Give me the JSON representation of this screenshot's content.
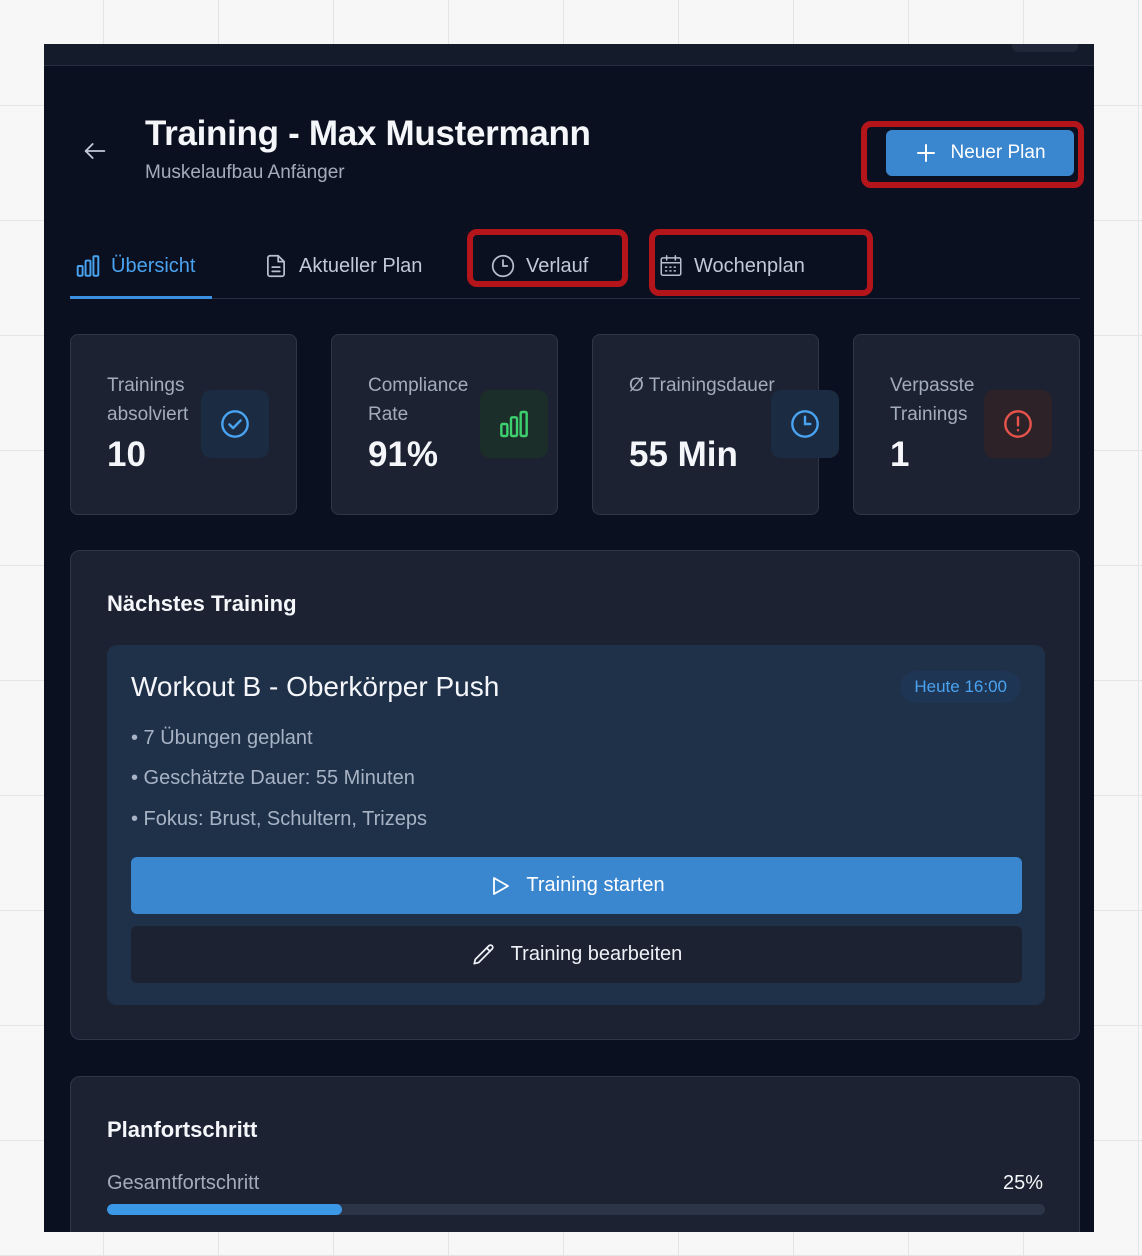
{
  "header": {
    "title": "Training - Max Mustermann",
    "subtitle": "Muskelaufbau Anfänger",
    "new_plan_label": "Neuer Plan",
    "icons": {
      "back": "arrow-left-icon",
      "new_plan": "plus-icon"
    }
  },
  "tabs": [
    {
      "label": "Übersicht",
      "icon": "bar-chart-icon",
      "active": true
    },
    {
      "label": "Aktueller Plan",
      "icon": "document-icon",
      "active": false
    },
    {
      "label": "Verlauf",
      "icon": "clock-icon",
      "active": false
    },
    {
      "label": "Wochenplan",
      "icon": "calendar-icon",
      "active": false
    }
  ],
  "stats": [
    {
      "label": "Trainings absolviert",
      "value": "10",
      "icon": "check-circle-icon",
      "color": "#4aa3f0"
    },
    {
      "label": "Compliance Rate",
      "value": "91%",
      "icon": "bar-chart-icon",
      "color": "#3ecf6e"
    },
    {
      "label": "Ø Trainingsdauer",
      "value": "55 Min",
      "icon": "clock-icon",
      "color": "#4aa3f0"
    },
    {
      "label": "Verpasste Trainings",
      "value": "1",
      "icon": "alert-circle-icon",
      "color": "#e5534b"
    }
  ],
  "next_training": {
    "heading": "Nächstes Training",
    "workout_title": "Workout B - Oberkörper Push",
    "time_badge": "Heute 16:00",
    "bullets": [
      "• 7 Übungen geplant",
      "• Geschätzte Dauer: 55 Minuten",
      "• Fokus: Brust, Schultern, Trizeps"
    ],
    "start_label": "Training starten",
    "edit_label": "Training bearbeiten",
    "icons": {
      "start": "play-icon",
      "edit": "pencil-icon"
    }
  },
  "plan_progress": {
    "heading": "Planfortschritt",
    "label": "Gesamtfortschritt",
    "value_text": "25%",
    "fraction": 0.25
  },
  "colors": {
    "accent": "#3a86cf",
    "highlight": "#b3151b",
    "background": "#0b1020",
    "card": "#1c2231"
  }
}
